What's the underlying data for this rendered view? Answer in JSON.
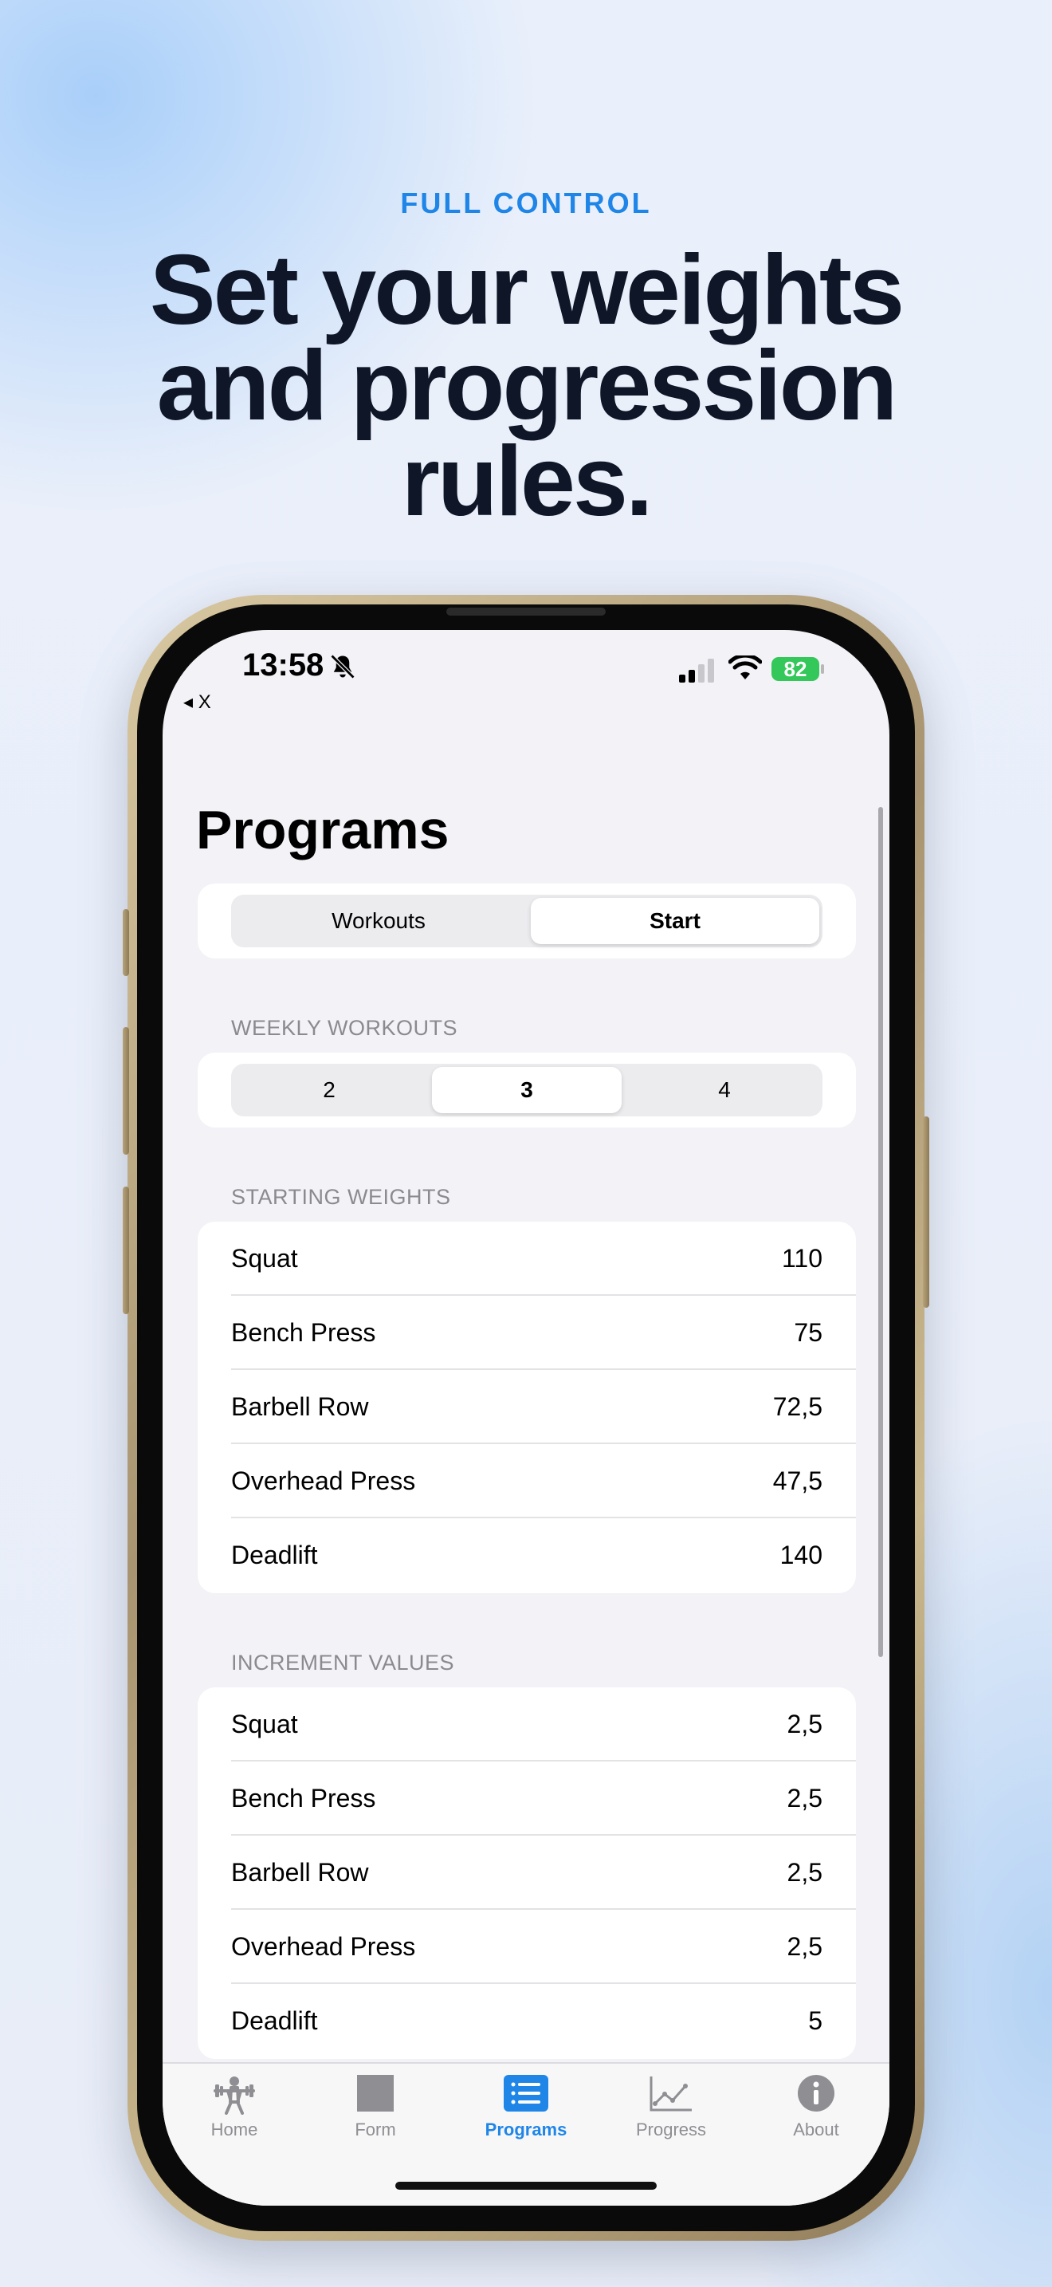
{
  "marketing": {
    "eyebrow": "FULL CONTROL",
    "headline_lines": [
      "Set your weights",
      "and progression",
      "rules."
    ]
  },
  "status_bar": {
    "time": "13:58",
    "back_label": "◂ X",
    "battery": "82"
  },
  "page": {
    "title": "Programs"
  },
  "mode_segment": {
    "options": [
      "Workouts",
      "Start"
    ],
    "selected": "Start"
  },
  "weekly_workouts": {
    "label": "WEEKLY WORKOUTS",
    "options": [
      "2",
      "3",
      "4"
    ],
    "selected": "3"
  },
  "starting_weights": {
    "label": "STARTING WEIGHTS",
    "rows": [
      {
        "name": "Squat",
        "value": "110"
      },
      {
        "name": "Bench Press",
        "value": "75"
      },
      {
        "name": "Barbell Row",
        "value": "72,5"
      },
      {
        "name": "Overhead Press",
        "value": "47,5"
      },
      {
        "name": "Deadlift",
        "value": "140"
      }
    ]
  },
  "increment_values": {
    "label": "INCREMENT VALUES",
    "rows": [
      {
        "name": "Squat",
        "value": "2,5"
      },
      {
        "name": "Bench Press",
        "value": "2,5"
      },
      {
        "name": "Barbell Row",
        "value": "2,5"
      },
      {
        "name": "Overhead Press",
        "value": "2,5"
      },
      {
        "name": "Deadlift",
        "value": "5"
      }
    ]
  },
  "tab_bar": {
    "items": [
      {
        "label": "Home",
        "icon": "barbell-lifter-icon"
      },
      {
        "label": "Form",
        "icon": "square-icon"
      },
      {
        "label": "Programs",
        "icon": "list-icon"
      },
      {
        "label": "Progress",
        "icon": "line-chart-icon"
      },
      {
        "label": "About",
        "icon": "info-icon"
      }
    ],
    "selected": "Programs"
  },
  "colors": {
    "accent": "#1f86e8",
    "battery": "#34c759",
    "headline": "#0e1627"
  }
}
